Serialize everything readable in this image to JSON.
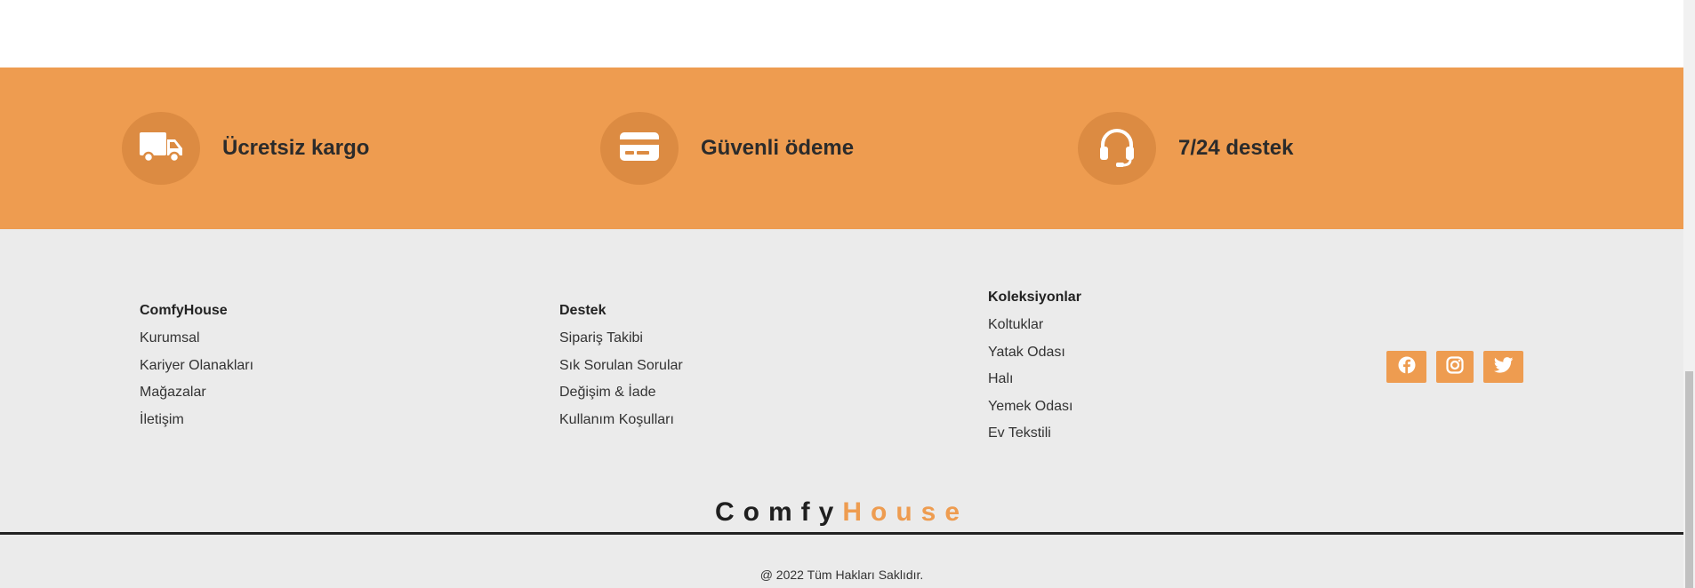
{
  "features": [
    {
      "icon": "truck-icon",
      "label": "Ücretsiz kargo"
    },
    {
      "icon": "credit-card-icon",
      "label": "Güvenli ödeme"
    },
    {
      "icon": "headset-icon",
      "label": "7/24 destek"
    }
  ],
  "footer": {
    "columns": [
      {
        "heading": "ComfyHouse",
        "links": [
          "Kurumsal",
          "Kariyer Olanakları",
          "Mağazalar",
          "İletişim"
        ]
      },
      {
        "heading": "Destek",
        "links": [
          "Sipariş Takibi",
          "Sık Sorulan Sorular",
          "Değişim & İade",
          "Kullanım Koşulları"
        ]
      },
      {
        "heading": "Koleksiyonlar",
        "links": [
          "Koltuklar",
          "Yatak Odası",
          "Halı",
          "Yemek Odası",
          "Ev Tekstili"
        ]
      }
    ],
    "social": [
      "facebook-icon",
      "instagram-icon",
      "twitter-icon"
    ],
    "brand": {
      "part1": "Comfy",
      "part2": "House"
    },
    "copyright": "@ 2022 Tüm Hakları Saklıdır."
  },
  "colors": {
    "accent": "#ee9c50",
    "icon_circle": "#dc8b42",
    "footer_bg": "#ebebeb",
    "dark": "#1f1f1f"
  }
}
